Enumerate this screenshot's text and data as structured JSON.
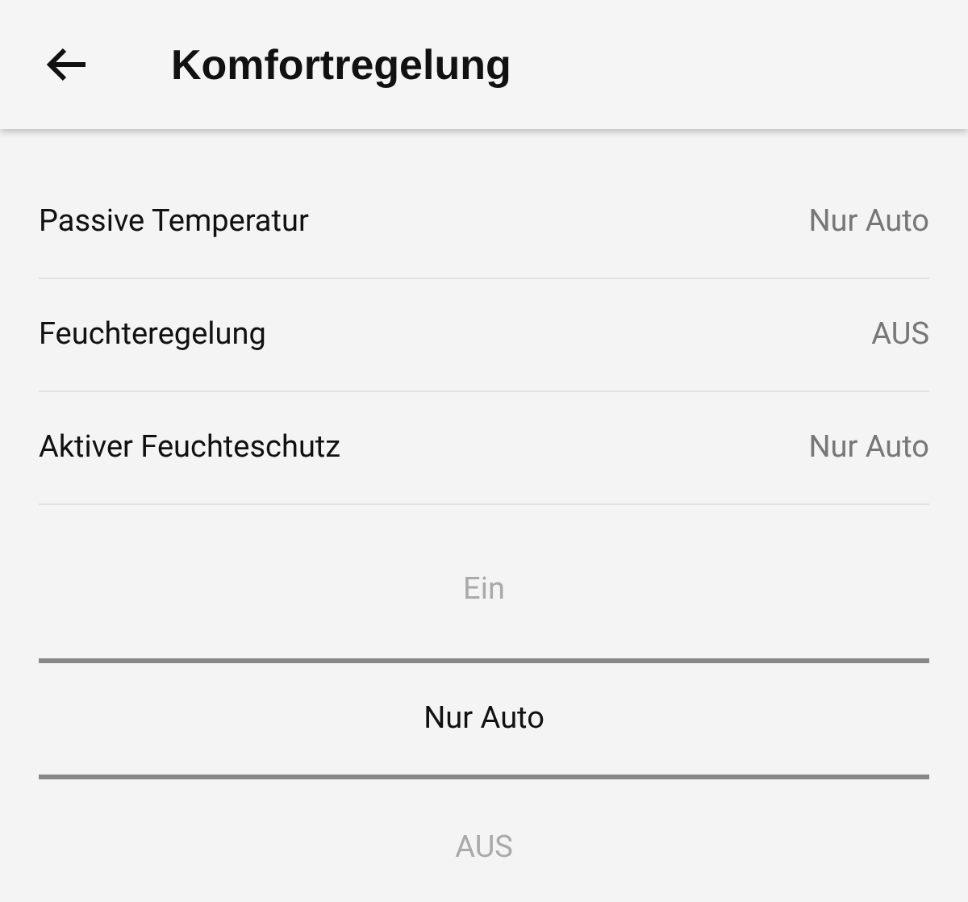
{
  "header": {
    "title": "Komfortregelung"
  },
  "settings": [
    {
      "label": "Passive Temperatur",
      "value": "Nur Auto"
    },
    {
      "label": "Feuchteregelung",
      "value": "AUS"
    },
    {
      "label": "Aktiver Feuchteschutz",
      "value": "Nur Auto"
    }
  ],
  "picker": [
    {
      "label": "Ein",
      "selected": false
    },
    {
      "label": "Nur Auto",
      "selected": true
    },
    {
      "label": "AUS",
      "selected": false
    }
  ]
}
